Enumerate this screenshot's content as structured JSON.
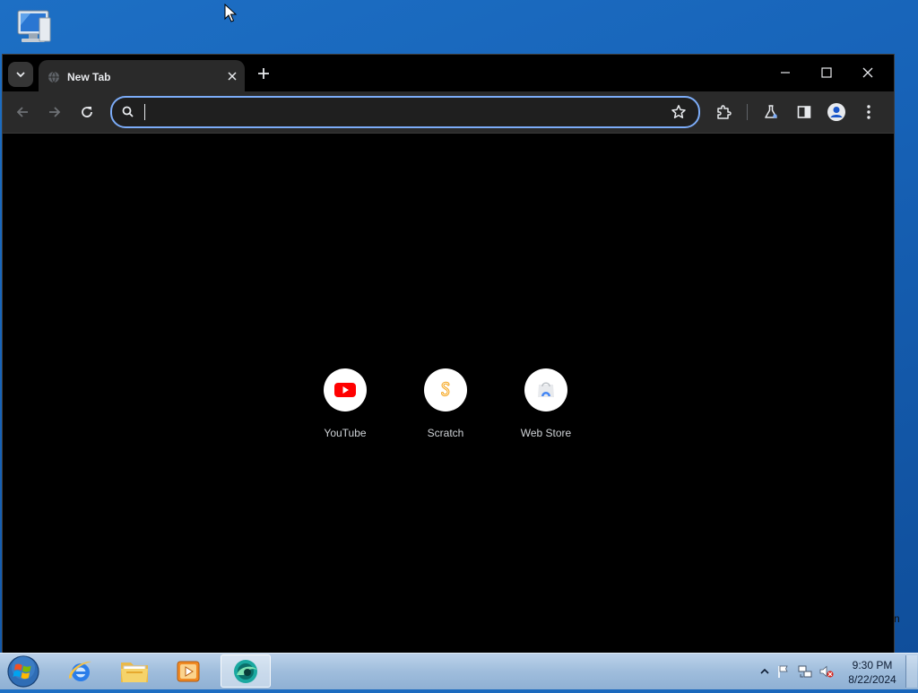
{
  "browser": {
    "tab": {
      "title": "New Tab"
    },
    "omnibox": {
      "value": "",
      "placeholder": ""
    }
  },
  "shortcuts": [
    {
      "label": "YouTube",
      "icon": "youtube-icon"
    },
    {
      "label": "Scratch",
      "icon": "scratch-icon"
    },
    {
      "label": "Web Store",
      "icon": "web-store-icon"
    }
  ],
  "desktop": {
    "stray_text": "n",
    "icons": [
      "computer-icon"
    ]
  },
  "taskbar": {
    "apps": [
      "internet-explorer-icon",
      "file-explorer-icon",
      "media-player-icon",
      "browser-icon"
    ],
    "tray": [
      "show-hidden-icons-icon",
      "action-center-flag-icon",
      "network-icon",
      "volume-muted-icon"
    ],
    "clock": {
      "time": "9:30 PM",
      "date": "8/22/2024"
    }
  },
  "colors": {
    "desktop": "#1763b8",
    "window": "#000000",
    "toolbar": "#2a2a2a",
    "omnibox_focus": "#7cacf8",
    "youtube_red": "#ff0000",
    "scratch_orange": "#f5a623"
  }
}
